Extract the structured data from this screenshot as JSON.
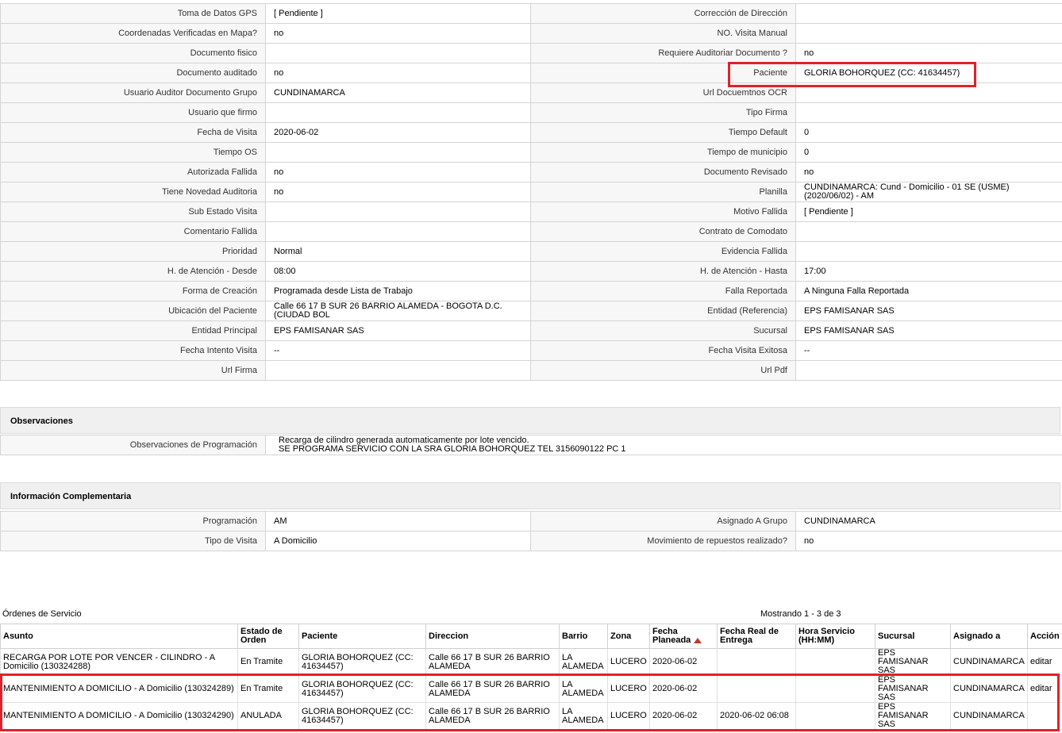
{
  "detail_rows": [
    {
      "l1": "Toma de Datos GPS",
      "v1": "[ Pendiente ]",
      "l2": "Corrección de Dirección",
      "v2": ""
    },
    {
      "l1": "Coordenadas Verificadas en Mapa?",
      "v1": "no",
      "l2": "NO. Visita Manual",
      "v2": ""
    },
    {
      "l1": "Documento fisico",
      "v1": "",
      "l2": "Requiere Auditoriar Documento ?",
      "v2": "no"
    },
    {
      "l1": "Documento auditado",
      "v1": "no",
      "l2": "Paciente",
      "v2": "GLORIA BOHORQUEZ (CC: 41634457)"
    },
    {
      "l1": "Usuario Auditor Documento Grupo",
      "v1": "CUNDINAMARCA",
      "l2": "Url Docuemtnos OCR",
      "v2": ""
    },
    {
      "l1": "Usuario que firmo",
      "v1": "",
      "l2": "Tipo Firma",
      "v2": ""
    },
    {
      "l1": "Fecha de Visita",
      "v1": "2020-06-02",
      "l2": "Tiempo Default",
      "v2": "0"
    },
    {
      "l1": "Tiempo OS",
      "v1": "",
      "l2": "Tiempo de municipio",
      "v2": "0"
    },
    {
      "l1": "Autorizada Fallida",
      "v1": "no",
      "l2": "Documento Revisado",
      "v2": "no"
    },
    {
      "l1": "Tiene Novedad Auditoria",
      "v1": "no",
      "l2": "Planilla",
      "v2": "CUNDINAMARCA: Cund - Domicilio - 01 SE (USME) (2020/06/02) - AM"
    },
    {
      "l1": "Sub Estado Visita",
      "v1": "",
      "l2": "Motivo Fallida",
      "v2": "[ Pendiente ]"
    },
    {
      "l1": "Comentario Fallida",
      "v1": "",
      "l2": "Contrato de Comodato",
      "v2": ""
    },
    {
      "l1": "Prioridad",
      "v1": "Normal",
      "l2": "Evidencia Fallida",
      "v2": ""
    },
    {
      "l1": "H. de Atención - Desde",
      "v1": "08:00",
      "l2": "H. de Atención - Hasta",
      "v2": "17:00"
    },
    {
      "l1": "Forma de Creación",
      "v1": "Programada desde Lista de Trabajo",
      "l2": "Falla Reportada",
      "v2": "A Ninguna Falla Reportada"
    },
    {
      "l1": "Ubicación del Paciente",
      "v1": "Calle 66 17 B SUR 26 BARRIO ALAMEDA - BOGOTA D.C. (CIUDAD BOL",
      "l2": "Entidad (Referencia)",
      "v2": "EPS FAMISANAR SAS"
    },
    {
      "l1": "Entidad Principal",
      "v1": "EPS FAMISANAR SAS",
      "l2": "Sucursal",
      "v2": "EPS FAMISANAR SAS"
    },
    {
      "l1": "Fecha Intento Visita",
      "v1": "--",
      "l2": "Fecha Visita Exitosa",
      "v2": "--"
    },
    {
      "l1": "Url Firma",
      "v1": "",
      "l2": "Url Pdf",
      "v2": ""
    }
  ],
  "observaciones": {
    "title": "Observaciones",
    "label": "Observaciones de Programación",
    "line1": "Recarga de cilindro generada automaticamente por lote vencido.",
    "line2": "SE PROGRAMA SERVICIO CON LA SRA GLORIA BOHORQUEZ TEL 3156090122 PC 1"
  },
  "complementaria": {
    "title": "Información Complementaria",
    "rows": [
      {
        "l1": "Programación",
        "v1": "AM",
        "l2": "Asignado A Grupo",
        "v2": "CUNDINAMARCA"
      },
      {
        "l1": "Tipo de Visita",
        "v1": "A Domicilio",
        "l2": "Movimiento de repuestos realizado?",
        "v2": "no"
      }
    ]
  },
  "orders": {
    "title": "Órdenes de Servicio",
    "count_text": "Mostrando 1 - 3 de 3",
    "columns": [
      "Asunto",
      "Estado de Orden",
      "Paciente",
      "Direccion",
      "Barrio",
      "Zona",
      "Fecha Planeada",
      "Fecha Real de Entrega",
      "Hora Servicio (HH:MM)",
      "Sucursal",
      "Asignado a",
      "Acción"
    ],
    "rows": [
      [
        "RECARGA POR LOTE POR VENCER - CILINDRO - A Domicilio (130324288)",
        "En Tramite",
        "GLORIA BOHORQUEZ (CC: 41634457)",
        "Calle 66 17 B SUR 26 BARRIO ALAMEDA",
        "LA ALAMEDA",
        "LUCERO",
        "2020-06-02",
        "",
        "",
        "EPS FAMISANAR SAS",
        "CUNDINAMARCA",
        "editar"
      ],
      [
        "MANTENIMIENTO A DOMICILIO - A Domicilio (130324289)",
        "En Tramite",
        "GLORIA BOHORQUEZ (CC: 41634457)",
        "Calle 66 17 B SUR 26 BARRIO ALAMEDA",
        "LA ALAMEDA",
        "LUCERO",
        "2020-06-02",
        "",
        "",
        "EPS FAMISANAR SAS",
        "CUNDINAMARCA",
        "editar"
      ],
      [
        "MANTENIMIENTO A DOMICILIO - A Domicilio (130324290)",
        "ANULADA",
        "GLORIA BOHORQUEZ (CC: 41634457)",
        "Calle 66 17 B SUR 26 BARRIO ALAMEDA",
        "LA ALAMEDA",
        "LUCERO",
        "2020-06-02",
        "2020-06-02 06:08",
        "",
        "EPS FAMISANAR SAS",
        "CUNDINAMARCA",
        ""
      ]
    ]
  },
  "colors": {
    "highlight": "#e2202b",
    "label_bg": "#f7f7f7",
    "border": "#d4d4d4"
  }
}
